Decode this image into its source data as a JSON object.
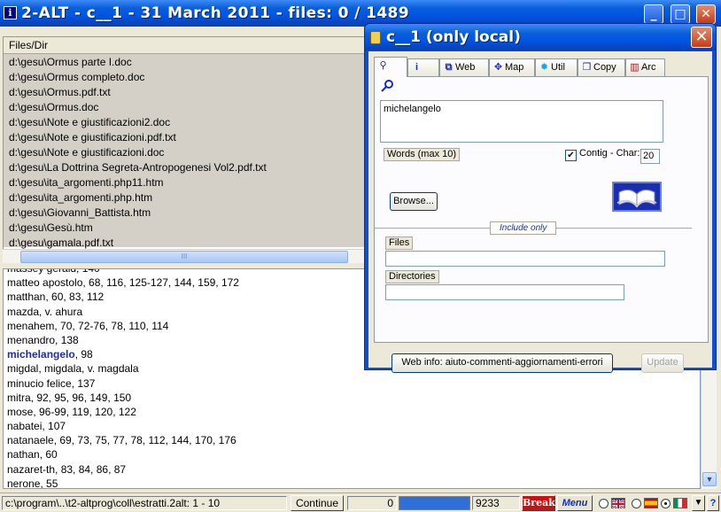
{
  "window": {
    "title": "2-ALT - c__1 - 31 March 2011 - files: 0 / 1489",
    "app_icon": "i",
    "caption_buttons": {
      "minimize": "_",
      "maximize": "□",
      "close": "✕"
    }
  },
  "filelist": {
    "header": "Files/Dir",
    "rows": [
      "d:\\gesu\\Ormus parte I.doc",
      "d:\\gesu\\Ormus completo.doc",
      "d:\\gesu\\Ormus.pdf.txt",
      "d:\\gesu\\Ormus.doc",
      "d:\\gesu\\Note e giustificazioni2.doc",
      "d:\\gesu\\Note e giustificazioni.pdf.txt",
      "d:\\gesu\\Note e giustificazioni.doc",
      "d:\\gesu\\La Dottrina Segreta-Antropogenesi Vol2.pdf.txt",
      "d:\\gesu\\ita_argomenti.php11.htm",
      "d:\\gesu\\ita_argomenti.php.htm",
      "d:\\gesu\\Giovanni_Battista.htm",
      "d:\\gesu\\Gesù.htm",
      "d:\\gesu\\gamala.pdf.txt"
    ],
    "scroll_grip": "III"
  },
  "index": {
    "rows": [
      {
        "text": "massey gerald, 140",
        "hl": false
      },
      {
        "text": "matteo apostolo, 68, 116, 125-127, 144, 159, 172",
        "hl": false
      },
      {
        "text": "matthan, 60, 83, 112",
        "hl": false
      },
      {
        "text": "mazda, v. ahura",
        "hl": false
      },
      {
        "text": "menahem, 70, 72-76, 78, 110, 114",
        "hl": false
      },
      {
        "text": "menandro, 138",
        "hl": false
      },
      {
        "text": "michelangelo",
        "suffix": ", 98",
        "hl": true
      },
      {
        "text": "migdal, migdala, v. magdala",
        "hl": false
      },
      {
        "text": "minucio felice, 137",
        "hl": false
      },
      {
        "text": "mitra, 92, 95, 96, 149, 150",
        "hl": false
      },
      {
        "text": "mose, 96-99, 119, 120, 122",
        "hl": false
      },
      {
        "text": "nabatei, 107",
        "hl": false
      },
      {
        "text": "natanaele, 69, 73, 75, 77, 78, 112, 144, 170, 176",
        "hl": false
      },
      {
        "text": "nathan, 60",
        "hl": false
      },
      {
        "text": "nazaret-th, 83, 84, 86, 87",
        "hl": false
      },
      {
        "text": "nerone, 55",
        "hl": false
      }
    ]
  },
  "statusbar": {
    "path": "c:\\program\\..\\t2-altprog\\coll\\estratti.2alt: 1 - 10",
    "continue": "Continue",
    "count_left": "0",
    "count_right": "9233",
    "progress": 0.55,
    "break": "Break",
    "menu": "Menu"
  },
  "dialog": {
    "title": "c__1 (only local)",
    "close": "✕",
    "tabs": [
      {
        "icon": "search-icon",
        "glyph": "⚲",
        "label": ""
      },
      {
        "icon": "info-icon",
        "glyph": "i",
        "label": ""
      },
      {
        "icon": "network-icon",
        "glyph": "⧉",
        "label": "Web"
      },
      {
        "icon": "map-icon",
        "glyph": "✥",
        "label": "Map"
      },
      {
        "icon": "util-icon",
        "glyph": "✹",
        "label": "Util"
      },
      {
        "icon": "copy-icon",
        "glyph": "❐",
        "label": "Copy"
      },
      {
        "icon": "archive-icon",
        "glyph": "▥",
        "label": "Arc"
      }
    ],
    "search_text": "michelangelo",
    "words_label": "Words (max 10)",
    "contig_label": "Contig - Char:",
    "contig_checked": true,
    "char_value": "20",
    "browse": "Browse...",
    "include_only": "Include only",
    "files_label": "Files",
    "dirs_label": "Directories",
    "files_value": "",
    "dirs_value": "",
    "webinfo": "Web info: aiuto-commenti-aggiornamenti-errori",
    "update": "Update"
  }
}
